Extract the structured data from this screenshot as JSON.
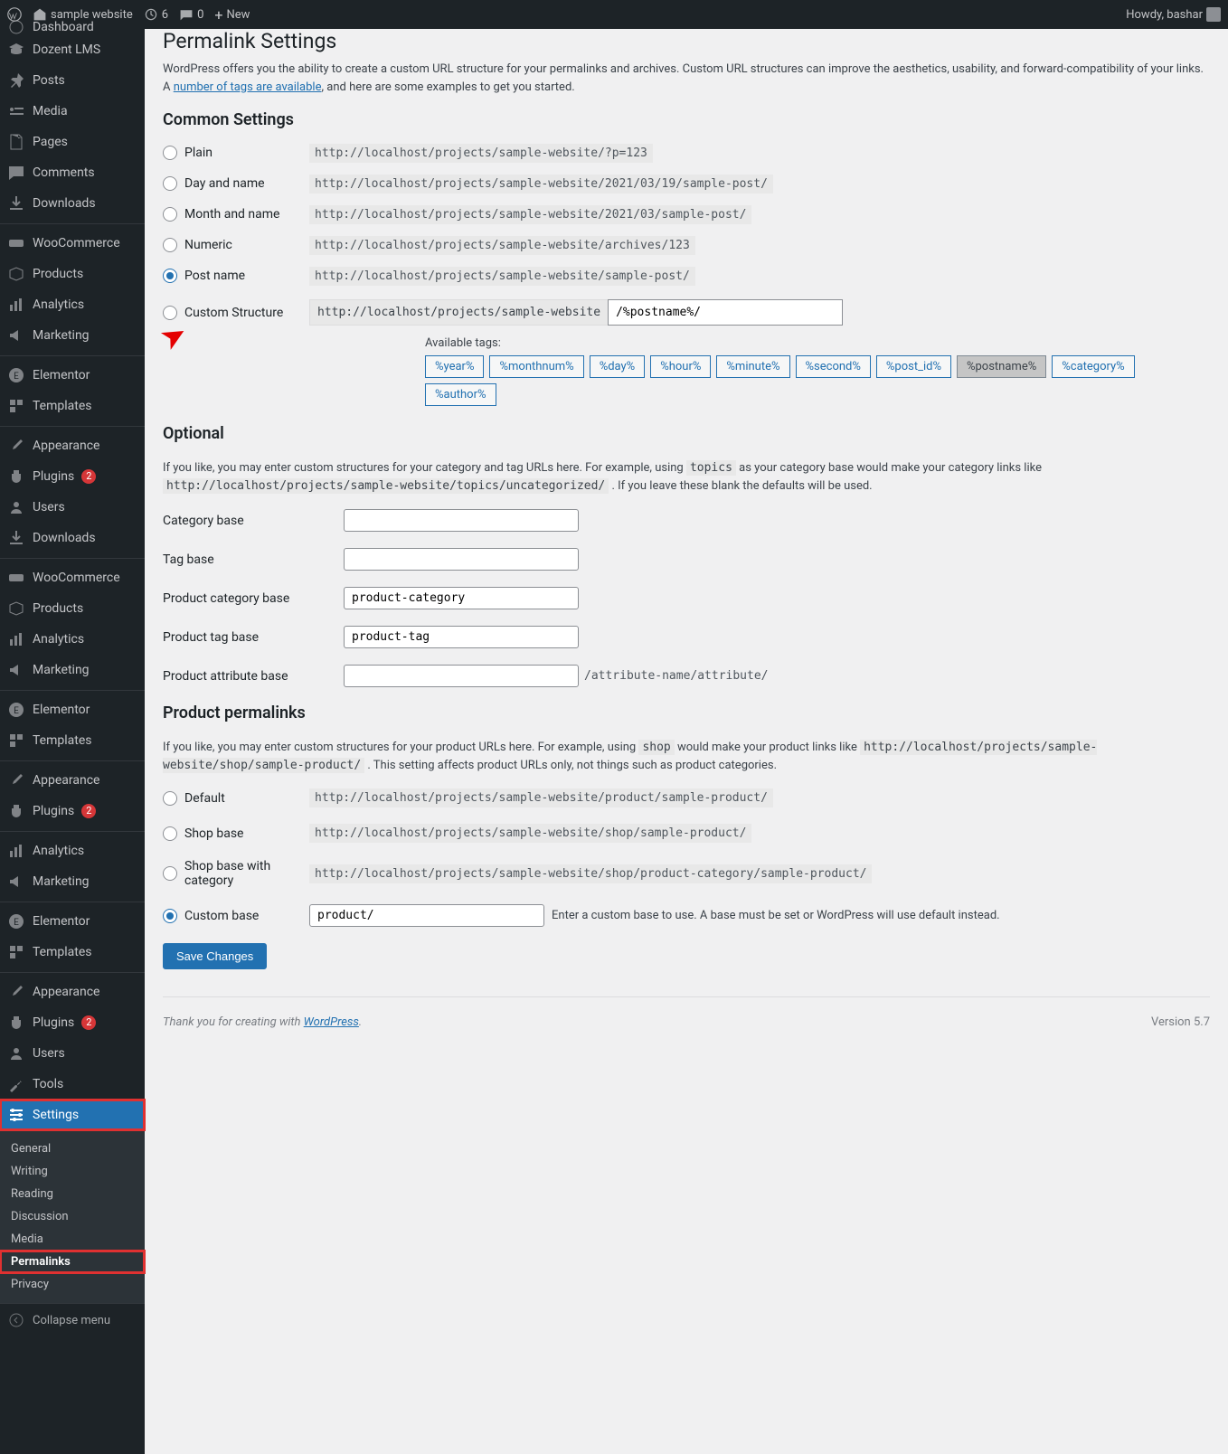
{
  "adminbar": {
    "site_name": "sample website",
    "updates": "6",
    "comments": "0",
    "new": "New",
    "howdy": "Howdy, bashar"
  },
  "sidebar": {
    "items": [
      {
        "icon": "dashboard",
        "label": "Dashboard",
        "cut": true
      },
      {
        "icon": "cap",
        "label": "Dozent LMS"
      },
      {
        "icon": "pin",
        "label": "Posts"
      },
      {
        "icon": "media",
        "label": "Media"
      },
      {
        "icon": "page",
        "label": "Pages"
      },
      {
        "icon": "comments",
        "label": "Comments"
      },
      {
        "icon": "download",
        "label": "Downloads"
      },
      {
        "sep": true
      },
      {
        "icon": "woo",
        "label": "WooCommerce"
      },
      {
        "icon": "box",
        "label": "Products"
      },
      {
        "icon": "bars",
        "label": "Analytics"
      },
      {
        "icon": "mega",
        "label": "Marketing"
      },
      {
        "sep": true
      },
      {
        "icon": "e",
        "label": "Elementor"
      },
      {
        "icon": "templates",
        "label": "Templates"
      },
      {
        "sep": true
      },
      {
        "icon": "brush",
        "label": "Appearance"
      },
      {
        "icon": "plug",
        "label": "Plugins",
        "badge": "2"
      },
      {
        "icon": "user",
        "label": "Users"
      },
      {
        "icon": "download",
        "label": "Downloads"
      },
      {
        "sep": true
      },
      {
        "icon": "woo",
        "label": "WooCommerce"
      },
      {
        "icon": "box",
        "label": "Products"
      },
      {
        "icon": "bars",
        "label": "Analytics"
      },
      {
        "icon": "mega",
        "label": "Marketing"
      },
      {
        "sep": true
      },
      {
        "icon": "e",
        "label": "Elementor"
      },
      {
        "icon": "templates",
        "label": "Templates"
      },
      {
        "sep": true
      },
      {
        "icon": "brush",
        "label": "Appearance"
      },
      {
        "icon": "plug",
        "label": "Plugins",
        "badge": "2"
      },
      {
        "sep": true
      },
      {
        "icon": "bars",
        "label": "Analytics"
      },
      {
        "icon": "mega",
        "label": "Marketing"
      },
      {
        "sep": true
      },
      {
        "icon": "e",
        "label": "Elementor"
      },
      {
        "icon": "templates",
        "label": "Templates"
      },
      {
        "sep": true
      },
      {
        "icon": "brush",
        "label": "Appearance"
      },
      {
        "icon": "plug",
        "label": "Plugins",
        "badge": "2"
      },
      {
        "icon": "user",
        "label": "Users"
      },
      {
        "icon": "wrench",
        "label": "Tools"
      },
      {
        "icon": "sliders",
        "label": "Settings",
        "current": true,
        "highlight": true
      }
    ],
    "submenu": [
      {
        "label": "General"
      },
      {
        "label": "Writing"
      },
      {
        "label": "Reading"
      },
      {
        "label": "Discussion"
      },
      {
        "label": "Media"
      },
      {
        "label": "Permalinks",
        "current": true,
        "highlight": true
      },
      {
        "label": "Privacy"
      }
    ],
    "collapse": "Collapse menu"
  },
  "page": {
    "title": "Permalink Settings",
    "desc_1": "WordPress offers you the ability to create a custom URL structure for your permalinks and archives. Custom URL structures can improve the aesthetics, usability, and forward-compatibility of your links. A ",
    "desc_link": "number of tags are available",
    "desc_2": ", and here are some examples to get you started.",
    "common_heading": "Common Settings",
    "options": [
      {
        "label": "Plain",
        "example": "http://localhost/projects/sample-website/?p=123"
      },
      {
        "label": "Day and name",
        "example": "http://localhost/projects/sample-website/2021/03/19/sample-post/"
      },
      {
        "label": "Month and name",
        "example": "http://localhost/projects/sample-website/2021/03/sample-post/"
      },
      {
        "label": "Numeric",
        "example": "http://localhost/projects/sample-website/archives/123"
      },
      {
        "label": "Post name",
        "example": "http://localhost/projects/sample-website/sample-post/",
        "checked": true
      },
      {
        "label": "Custom Structure",
        "prefix": "http://localhost/projects/sample-website",
        "value": "/%postname%/"
      }
    ],
    "available_tags_label": "Available tags:",
    "available_tags": [
      "%year%",
      "%monthnum%",
      "%day%",
      "%hour%",
      "%minute%",
      "%second%",
      "%post_id%",
      "%postname%",
      "%category%",
      "%author%"
    ],
    "selected_tag": "%postname%",
    "optional_heading": "Optional",
    "optional_desc_1": "If you like, you may enter custom structures for your category and tag URLs here. For example, using ",
    "optional_code1": "topics",
    "optional_desc_2": " as your category base would make your category links like ",
    "optional_code2": "http://localhost/projects/sample-website/topics/uncategorized/",
    "optional_desc_3": " . If you leave these blank the defaults will be used.",
    "fields": [
      {
        "label": "Category base",
        "value": ""
      },
      {
        "label": "Tag base",
        "value": ""
      },
      {
        "label": "Product category base",
        "value": "product-category"
      },
      {
        "label": "Product tag base",
        "value": "product-tag"
      },
      {
        "label": "Product attribute base",
        "value": "",
        "suffix": "/attribute-name/attribute/"
      }
    ],
    "product_heading": "Product permalinks",
    "product_desc_1": "If you like, you may enter custom structures for your product URLs here. For example, using ",
    "product_code1": "shop",
    "product_desc_2": " would make your product links like ",
    "product_code2": "http://localhost/projects/sample-website/shop/sample-product/",
    "product_desc_3": " . This setting affects product URLs only, not things such as product categories.",
    "product_options": [
      {
        "label": "Default",
        "example": "http://localhost/projects/sample-website/product/sample-product/"
      },
      {
        "label": "Shop base",
        "example": "http://localhost/projects/sample-website/shop/sample-product/"
      },
      {
        "label": "Shop base with category",
        "example": "http://localhost/projects/sample-website/shop/product-category/sample-product/"
      },
      {
        "label": "Custom base",
        "value": "product/",
        "checked": true,
        "help": "Enter a custom base to use. A base must be set or WordPress will use default instead."
      }
    ],
    "save": "Save Changes",
    "footer_1": "Thank you for creating with ",
    "footer_link": "WordPress",
    "footer_2": ".",
    "version": "Version 5.7"
  }
}
